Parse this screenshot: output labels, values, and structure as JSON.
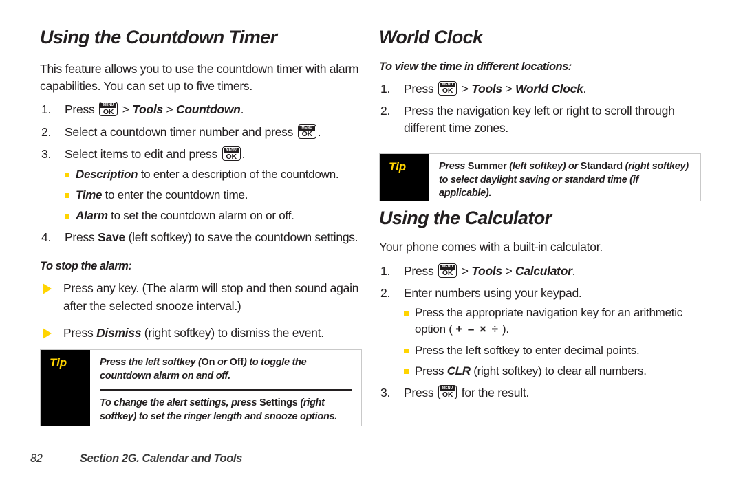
{
  "page": {
    "number": "82",
    "footer_section": "Section 2G. Calendar and Tools",
    "accent_yellow": "#ffd400",
    "text_color": "#231f20"
  },
  "icons": {
    "menu_ok_key": {
      "menu_label": "MENU",
      "ok_label": "OK",
      "name": "menu-ok-key-icon"
    },
    "square_bullet": "square-bullet-icon",
    "arrow_bullet": "triangle-arrow-bullet-icon"
  },
  "left_column": {
    "countdown": {
      "title": "Using the Countdown Timer",
      "intro": "This feature allows you to use the countdown timer with alarm capabilities. You can set up to five timers.",
      "steps": [
        {
          "num": "1.",
          "parts": [
            {
              "t": "text",
              "v": "Press "
            },
            {
              "t": "key"
            },
            {
              "t": "gt",
              "v": " > "
            },
            {
              "t": "ital",
              "v": "Tools"
            },
            {
              "t": "gt",
              "v": " > "
            },
            {
              "t": "ital",
              "v": "Countdown"
            },
            {
              "t": "text",
              "v": "."
            }
          ]
        },
        {
          "num": "2.",
          "parts": [
            {
              "t": "text",
              "v": "Select a countdown timer number and press "
            },
            {
              "t": "key"
            },
            {
              "t": "text",
              "v": "."
            }
          ]
        },
        {
          "num": "3.",
          "parts": [
            {
              "t": "text",
              "v": "Select items to edit and press "
            },
            {
              "t": "key"
            },
            {
              "t": "text",
              "v": "."
            }
          ],
          "sub": [
            {
              "label": "Description",
              "rest": " to enter a description of the countdown."
            },
            {
              "label": "Time",
              "rest": " to enter the countdown time."
            },
            {
              "label": "Alarm",
              "rest": " to set the countdown alarm on or off."
            }
          ]
        },
        {
          "num": "4.",
          "parts": [
            {
              "t": "text",
              "v": "Press "
            },
            {
              "t": "bold",
              "v": "Save"
            },
            {
              "t": "text",
              "v": " (left softkey) to save the countdown settings."
            }
          ]
        }
      ],
      "stop_alarm_subhead": "To stop the alarm:",
      "arrow_items": [
        [
          {
            "t": "text",
            "v": "Press any key. (The alarm will stop and then sound again after the selected snooze interval.)"
          }
        ],
        [
          {
            "t": "text",
            "v": "Press "
          },
          {
            "t": "bolditalic",
            "v": "Dismiss"
          },
          {
            "t": "text",
            "v": " (right softkey) to dismiss the event."
          }
        ]
      ],
      "tip": {
        "label": "Tip",
        "paragraphs": [
          [
            {
              "t": "ital",
              "v": "Press the left softkey ("
            },
            {
              "t": "boldupright",
              "v": "On"
            },
            {
              "t": "ital",
              "v": " or "
            },
            {
              "t": "boldupright",
              "v": "Off"
            },
            {
              "t": "ital",
              "v": ") to toggle the countdown alarm on and off."
            }
          ],
          [
            {
              "t": "ital",
              "v": "To change the alert settings, press "
            },
            {
              "t": "boldupright",
              "v": "Settings"
            },
            {
              "t": "ital",
              "v": " (right softkey) to set the ringer length and snooze options."
            }
          ]
        ]
      }
    }
  },
  "right_column": {
    "world_clock": {
      "title": "World Clock",
      "subhead": "To view the time in different locations:",
      "steps": [
        {
          "num": "1.",
          "parts": [
            {
              "t": "text",
              "v": "Press "
            },
            {
              "t": "key"
            },
            {
              "t": "gt",
              "v": " > "
            },
            {
              "t": "ital",
              "v": "Tools"
            },
            {
              "t": "gt",
              "v": " > "
            },
            {
              "t": "ital",
              "v": "World Clock"
            },
            {
              "t": "text",
              "v": "."
            }
          ]
        },
        {
          "num": "2.",
          "parts": [
            {
              "t": "text",
              "v": "Press the navigation key left or right to scroll through different time zones."
            }
          ]
        }
      ],
      "tip": {
        "label": "Tip",
        "paragraphs": [
          [
            {
              "t": "ital",
              "v": "Press "
            },
            {
              "t": "boldupright",
              "v": "Summer"
            },
            {
              "t": "ital",
              "v": " (left softkey) or "
            },
            {
              "t": "boldupright",
              "v": "Standard"
            },
            {
              "t": "ital",
              "v": " (right softkey) to select daylight saving or standard time (if applicable)."
            }
          ]
        ]
      }
    },
    "calculator": {
      "title": "Using the Calculator",
      "intro": "Your phone comes with a built-in calculator.",
      "steps": [
        {
          "num": "1.",
          "parts": [
            {
              "t": "text",
              "v": "Press "
            },
            {
              "t": "key"
            },
            {
              "t": "gt",
              "v": " > "
            },
            {
              "t": "ital",
              "v": "Tools"
            },
            {
              "t": "gt",
              "v": " > "
            },
            {
              "t": "ital",
              "v": "Calculator"
            },
            {
              "t": "text",
              "v": "."
            }
          ]
        },
        {
          "num": "2.",
          "parts": [
            {
              "t": "text",
              "v": "Enter numbers using your keypad."
            }
          ],
          "sub": [
            [
              {
                "t": "text",
                "v": "Press the appropriate navigation key for an arithmetic option ( "
              },
              {
                "t": "ops",
                "v": "+ – × ÷"
              },
              {
                "t": "text",
                "v": " )."
              }
            ],
            [
              {
                "t": "text",
                "v": "Press the left softkey to enter decimal points."
              }
            ],
            [
              {
                "t": "text",
                "v": "Press "
              },
              {
                "t": "bolditalic",
                "v": "CLR"
              },
              {
                "t": "text",
                "v": " (right softkey) to clear all numbers."
              }
            ]
          ]
        },
        {
          "num": "3.",
          "parts": [
            {
              "t": "text",
              "v": "Press "
            },
            {
              "t": "key"
            },
            {
              "t": "text",
              "v": " for the result."
            }
          ]
        }
      ]
    }
  }
}
